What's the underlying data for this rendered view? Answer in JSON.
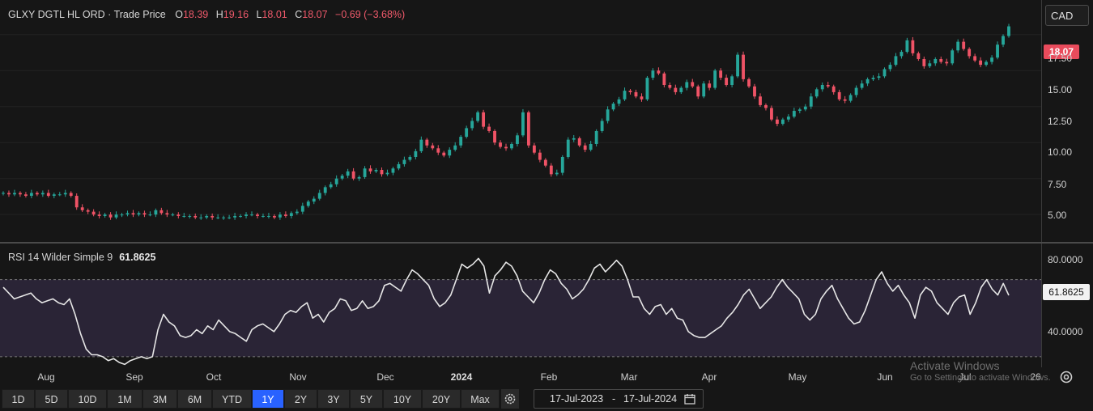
{
  "header": {
    "title": "GLXY DGTL HL ORD · Trade Price",
    "open_label": "O",
    "open": "18.39",
    "high_label": "H",
    "high": "19.16",
    "low_label": "L",
    "low": "18.01",
    "close_label": "C",
    "close": "18.07",
    "change": "−0.69 (−3.68%)"
  },
  "currency": "CAD",
  "last_price_label": "18.07",
  "rsi": {
    "title": "RSI 14 Wilder Simple 9",
    "value": "61.8625",
    "tag": "61.8625"
  },
  "price_ticks": [
    "17.50",
    "15.00",
    "12.50",
    "10.00",
    "7.50",
    "5.00"
  ],
  "rsi_ticks": [
    "80.0000",
    "40.0000"
  ],
  "x_ticks": [
    "Aug",
    "Sep",
    "Oct",
    "Nov",
    "Dec",
    "2024",
    "Feb",
    "Mar",
    "Apr",
    "May",
    "Jun",
    "Jul",
    "26"
  ],
  "ranges": [
    "1D",
    "5D",
    "10D",
    "1M",
    "3M",
    "6M",
    "YTD",
    "1Y",
    "2Y",
    "3Y",
    "5Y",
    "10Y",
    "20Y",
    "Max"
  ],
  "active_range": "1Y",
  "date_from": "17-Jul-2023",
  "date_sep": "-",
  "date_to": "17-Jul-2024",
  "watermark": {
    "line1": "Activate Windows",
    "line2": "Go to Settings to activate Windows."
  },
  "colors": {
    "up": "#26a69a",
    "down": "#ef5366",
    "rsi_line": "#e6e6e6",
    "rsi_band": "#2a2436",
    "bg": "#161616"
  },
  "chart_data": [
    {
      "type": "candlestick",
      "title": "GLXY DGTL HL ORD · Trade Price",
      "y_ticks": [
        5.0,
        7.5,
        10.0,
        12.5,
        15.0,
        17.5
      ],
      "ylim": [
        3.1,
        19.9
      ],
      "x_range": [
        "17-Jul-2023",
        "17-Jul-2024"
      ],
      "close_series": [
        6.5,
        6.4,
        6.5,
        6.4,
        6.3,
        6.5,
        6.4,
        6.5,
        6.3,
        6.4,
        6.4,
        6.5,
        6.3,
        5.5,
        5.3,
        5.2,
        5.0,
        4.9,
        5.0,
        4.8,
        5.0,
        5.0,
        5.1,
        5.0,
        5.1,
        5.0,
        5.0,
        5.3,
        5.1,
        5.0,
        5.0,
        4.9,
        4.9,
        4.9,
        4.8,
        4.8,
        4.9,
        4.8,
        4.8,
        4.8,
        4.8,
        4.9,
        4.9,
        5.0,
        5.0,
        4.9,
        4.9,
        4.9,
        4.8,
        5.0,
        4.9,
        5.1,
        5.2,
        5.6,
        5.9,
        6.1,
        6.5,
        6.9,
        7.1,
        7.5,
        7.7,
        8.0,
        7.5,
        7.6,
        8.2,
        8.0,
        8.1,
        7.8,
        7.9,
        8.2,
        8.5,
        8.8,
        9.0,
        9.4,
        10.2,
        9.8,
        9.6,
        9.3,
        9.1,
        9.5,
        9.8,
        10.4,
        11.0,
        11.5,
        12.1,
        11.1,
        10.8,
        10.0,
        9.7,
        9.6,
        9.9,
        10.5,
        12.1,
        9.8,
        9.3,
        8.8,
        8.4,
        7.8,
        7.9,
        9.0,
        10.2,
        10.3,
        9.8,
        9.5,
        9.9,
        10.8,
        11.5,
        12.3,
        12.7,
        13.0,
        13.6,
        13.5,
        13.2,
        13.0,
        14.5,
        15.0,
        14.8,
        14.0,
        13.8,
        13.5,
        13.8,
        14.2,
        13.9,
        13.2,
        14.1,
        13.8,
        15.0,
        14.5,
        14.0,
        14.6,
        16.1,
        14.4,
        13.9,
        13.2,
        12.6,
        12.4,
        11.6,
        11.3,
        11.6,
        11.8,
        12.2,
        12.3,
        12.5,
        13.2,
        13.7,
        14.0,
        13.9,
        13.5,
        13.0,
        12.9,
        13.3,
        13.8,
        14.1,
        14.4,
        14.5,
        14.6,
        15.1,
        15.4,
        16.0,
        16.3,
        17.1,
        16.2,
        15.8,
        15.3,
        15.5,
        15.8,
        15.6,
        15.5,
        16.4,
        17.0,
        16.5,
        16.0,
        15.7,
        15.4,
        15.6,
        15.9,
        16.8,
        17.4,
        18.07
      ]
    },
    {
      "type": "line",
      "title": "RSI 14 Wilder Simple 9",
      "y_ticks": [
        40.0,
        80.0
      ],
      "ylim": [
        24.5,
        88.7
      ],
      "band": [
        30,
        70
      ],
      "values": [
        66,
        63,
        60,
        61,
        62,
        63,
        60,
        58,
        59,
        60,
        58,
        57,
        60,
        52,
        42,
        34,
        31,
        31,
        30,
        28,
        29,
        27,
        26,
        28,
        29,
        30,
        29,
        30,
        44,
        52,
        48,
        46,
        41,
        40,
        41,
        44,
        42,
        46,
        44,
        49,
        46,
        43,
        42,
        40,
        38,
        44,
        46,
        47,
        45,
        43,
        47,
        52,
        54,
        53,
        56,
        58,
        50,
        52,
        48,
        53,
        55,
        60,
        59,
        54,
        55,
        59,
        55,
        56,
        59,
        67,
        68,
        66,
        64,
        70,
        75,
        73,
        70,
        67,
        60,
        56,
        58,
        62,
        70,
        78,
        76,
        78,
        81,
        77,
        63,
        72,
        75,
        79,
        77,
        72,
        64,
        61,
        58,
        63,
        70,
        75,
        73,
        68,
        65,
        60,
        62,
        65,
        70,
        76,
        78,
        74,
        77,
        80,
        77,
        70,
        61,
        61,
        55,
        52,
        56,
        57,
        52,
        55,
        50,
        49,
        43,
        41,
        40,
        40,
        42,
        44,
        46,
        50,
        53,
        57,
        62,
        65,
        60,
        55,
        58,
        61,
        66,
        70,
        66,
        63,
        60,
        52,
        49,
        52,
        60,
        64,
        67,
        60,
        55,
        50,
        47,
        48,
        54,
        62,
        70,
        74,
        68,
        64,
        67,
        62,
        58,
        50,
        62,
        66,
        64,
        58,
        55,
        52,
        58,
        61,
        62,
        52,
        58,
        66,
        70,
        65,
        62,
        68,
        61.8625
      ]
    }
  ]
}
